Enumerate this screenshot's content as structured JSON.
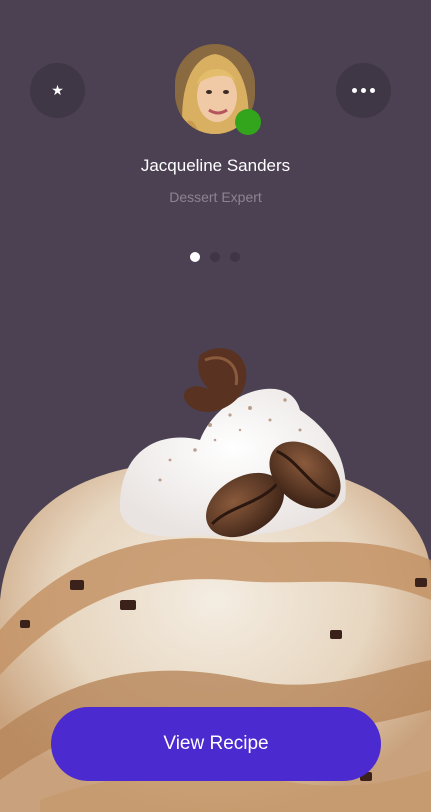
{
  "profile": {
    "name": "Jacqueline Sanders",
    "role": "Dessert Expert",
    "online": true
  },
  "header": {
    "left_icon": "star-icon",
    "right_icon": "more-dots-icon"
  },
  "pager": {
    "count": 3,
    "active_index": 0
  },
  "cta": {
    "label": "View Recipe"
  },
  "colors": {
    "background": "#4b4152",
    "button_bg": "#3f3646",
    "online": "#33a51c",
    "accent": "#4b2ad0",
    "subtle_text": "#8c8492"
  }
}
